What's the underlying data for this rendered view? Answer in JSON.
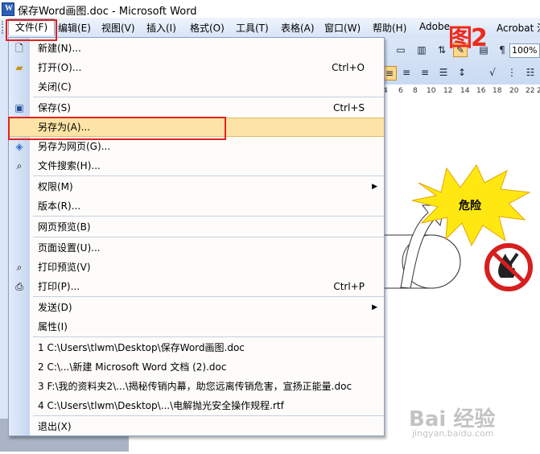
{
  "window": {
    "title": "保存Word画图.doc - Microsoft Word",
    "app_icon": "W"
  },
  "menubar": {
    "items": [
      "文件(F)",
      "编辑(E)",
      "视图(V)",
      "插入(I)",
      "格式(O)",
      "工具(T)",
      "表格(A)",
      "窗口(W)",
      "帮助(H)",
      "Adobe",
      "Acrobat 注"
    ]
  },
  "toolbar": {
    "zoom": "100%"
  },
  "ruler": {
    "ticks": [
      "4",
      "6",
      "8",
      "10",
      "12",
      "14",
      "16",
      "18",
      "20",
      "22",
      "24"
    ]
  },
  "file_menu": {
    "items": [
      {
        "label": "新建(N)...",
        "shortcut": "",
        "icon": "new-doc-icon"
      },
      {
        "label": "打开(O)...",
        "shortcut": "Ctrl+O",
        "icon": "open-folder-icon"
      },
      {
        "label": "关闭(C)",
        "shortcut": "",
        "icon": ""
      },
      {
        "label": "保存(S)",
        "shortcut": "Ctrl+S",
        "icon": "save-icon"
      },
      {
        "label": "另存为(A)...",
        "shortcut": "",
        "icon": "",
        "highlighted": true
      },
      {
        "label": "另存为网页(G)...",
        "shortcut": "",
        "icon": "save-as-web-icon"
      },
      {
        "label": "文件搜索(H)...",
        "shortcut": "",
        "icon": "file-search-icon"
      },
      {
        "label": "权限(M)",
        "shortcut": "",
        "icon": "",
        "submenu": true
      },
      {
        "label": "版本(R)...",
        "shortcut": "",
        "icon": ""
      },
      {
        "label": "网页预览(B)",
        "shortcut": "",
        "icon": ""
      },
      {
        "label": "页面设置(U)...",
        "shortcut": "",
        "icon": ""
      },
      {
        "label": "打印预览(V)",
        "shortcut": "",
        "icon": "print-preview-icon"
      },
      {
        "label": "打印(P)...",
        "shortcut": "Ctrl+P",
        "icon": "print-icon"
      },
      {
        "label": "发送(D)",
        "shortcut": "",
        "icon": "",
        "submenu": true
      },
      {
        "label": "属性(I)",
        "shortcut": "",
        "icon": ""
      },
      {
        "label": "1 C:\\Users\\tlwm\\Desktop\\保存Word画图.doc",
        "shortcut": "",
        "icon": ""
      },
      {
        "label": "2 C:\\...\\新建 Microsoft Word 文档 (2).doc",
        "shortcut": "",
        "icon": ""
      },
      {
        "label": "3 F:\\我的资料夹2\\...\\揭秘传销内幕，助您远离传销危害，宣扬正能量.doc",
        "shortcut": "",
        "icon": ""
      },
      {
        "label": "4 C:\\Users\\tlwm\\Desktop\\...\\电解抛光安全操作规程.rtf",
        "shortcut": "",
        "icon": ""
      },
      {
        "label": "退出(X)",
        "shortcut": "",
        "icon": ""
      }
    ]
  },
  "annotation": {
    "figure_label": "图2"
  },
  "drawing": {
    "burst_text": "危险"
  },
  "watermark": {
    "logo": "Bai 经验",
    "url": "jingyan.baidu.com"
  },
  "colors": {
    "highlight": "#fde4a6",
    "annotation_red": "#e02222",
    "burst_yellow": "#ffe812",
    "no_sign_red": "#d61f1f"
  }
}
